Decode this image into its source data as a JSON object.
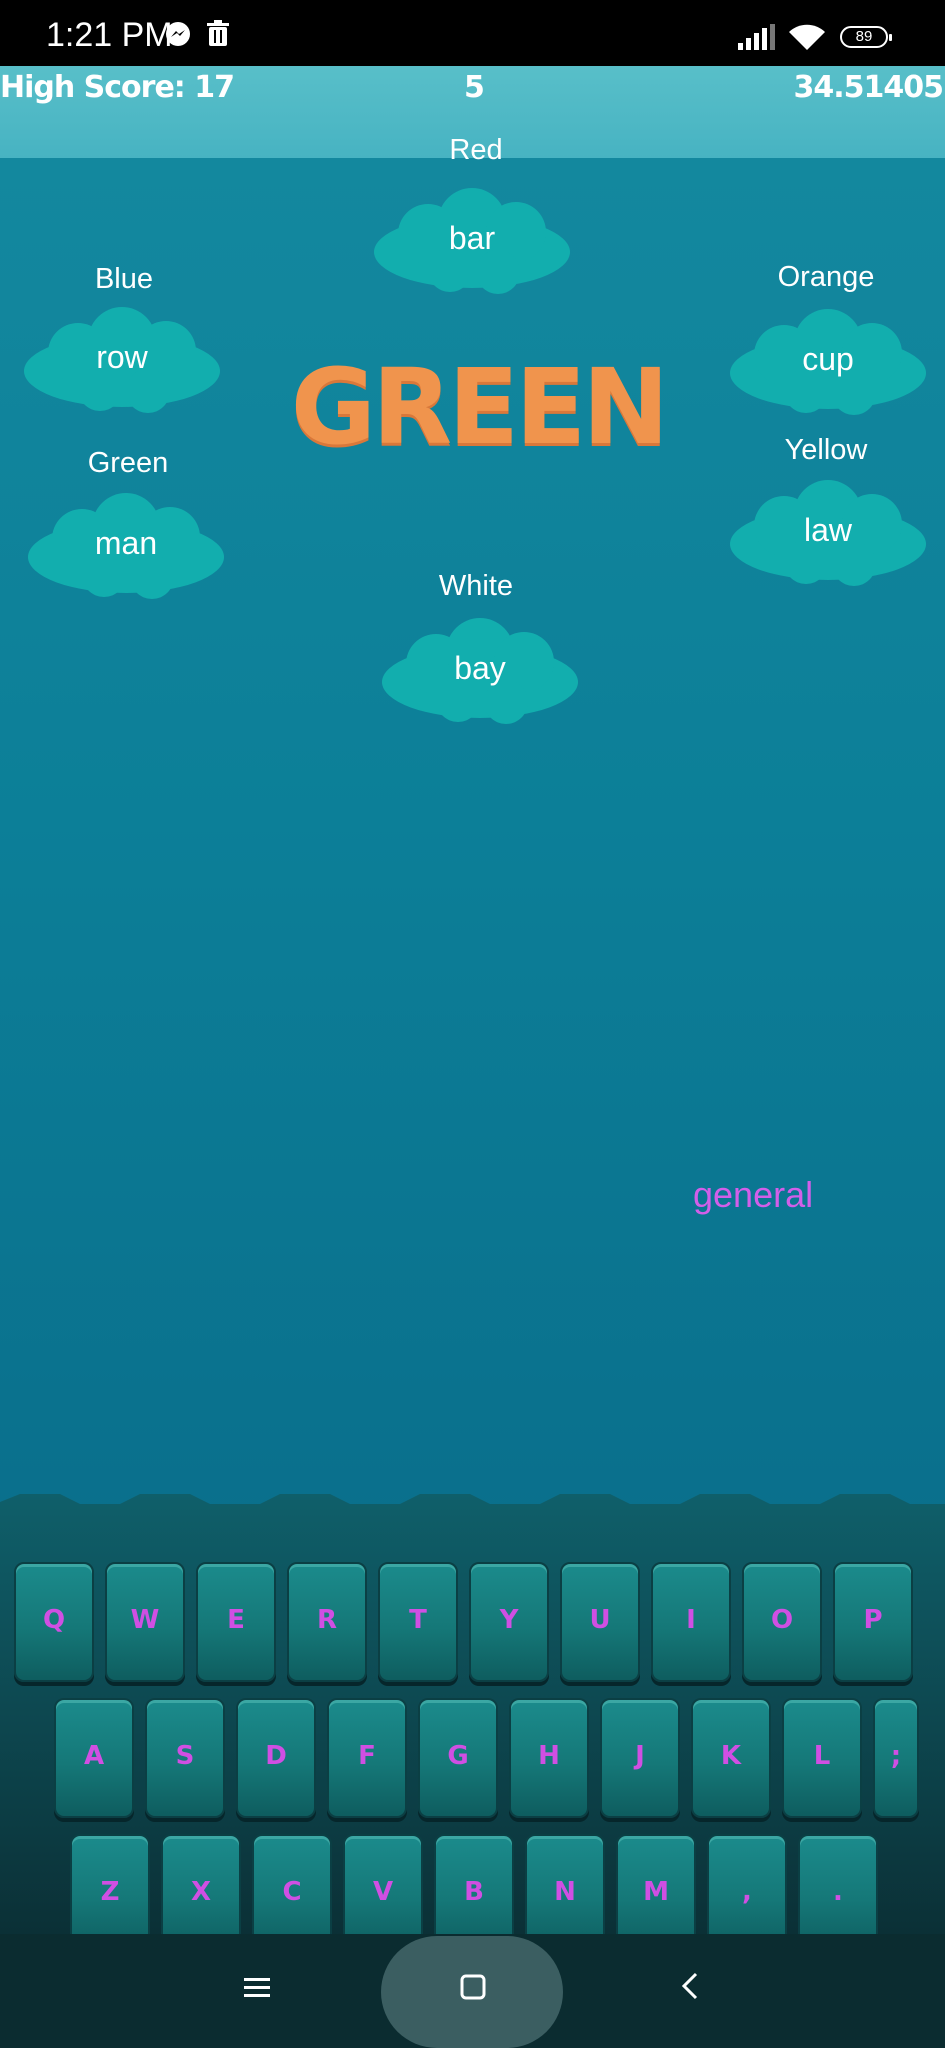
{
  "status_bar": {
    "time": "1:21 PM",
    "battery": "89"
  },
  "game": {
    "high_score_label": "High Score: 17",
    "level": "5",
    "timer": "34.51405",
    "target_word": "GREEN",
    "falling_word": "general",
    "colors": {
      "target_word": "#f0944d",
      "cloud": "#12aeae",
      "falling_word": "#d25fe9",
      "key_letter": "#d04fe3"
    }
  },
  "clouds": [
    {
      "label": "Red",
      "word": "bar"
    },
    {
      "label": "Blue",
      "word": "row"
    },
    {
      "label": "Orange",
      "word": "cup"
    },
    {
      "label": "Green",
      "word": "man"
    },
    {
      "label": "Yellow",
      "word": "law"
    },
    {
      "label": "White",
      "word": "bay"
    }
  ],
  "keyboard": {
    "rows": [
      [
        "Q",
        "W",
        "E",
        "R",
        "T",
        "Y",
        "U",
        "I",
        "O",
        "P"
      ],
      [
        "A",
        "S",
        "D",
        "F",
        "G",
        "H",
        "J",
        "K",
        "L",
        ";"
      ],
      [
        "Z",
        "X",
        "C",
        "V",
        "B",
        "N",
        "M",
        ",",
        "."
      ]
    ]
  },
  "nav_bar": {
    "icons": [
      "menu-icon",
      "home-icon",
      "back-icon"
    ]
  }
}
